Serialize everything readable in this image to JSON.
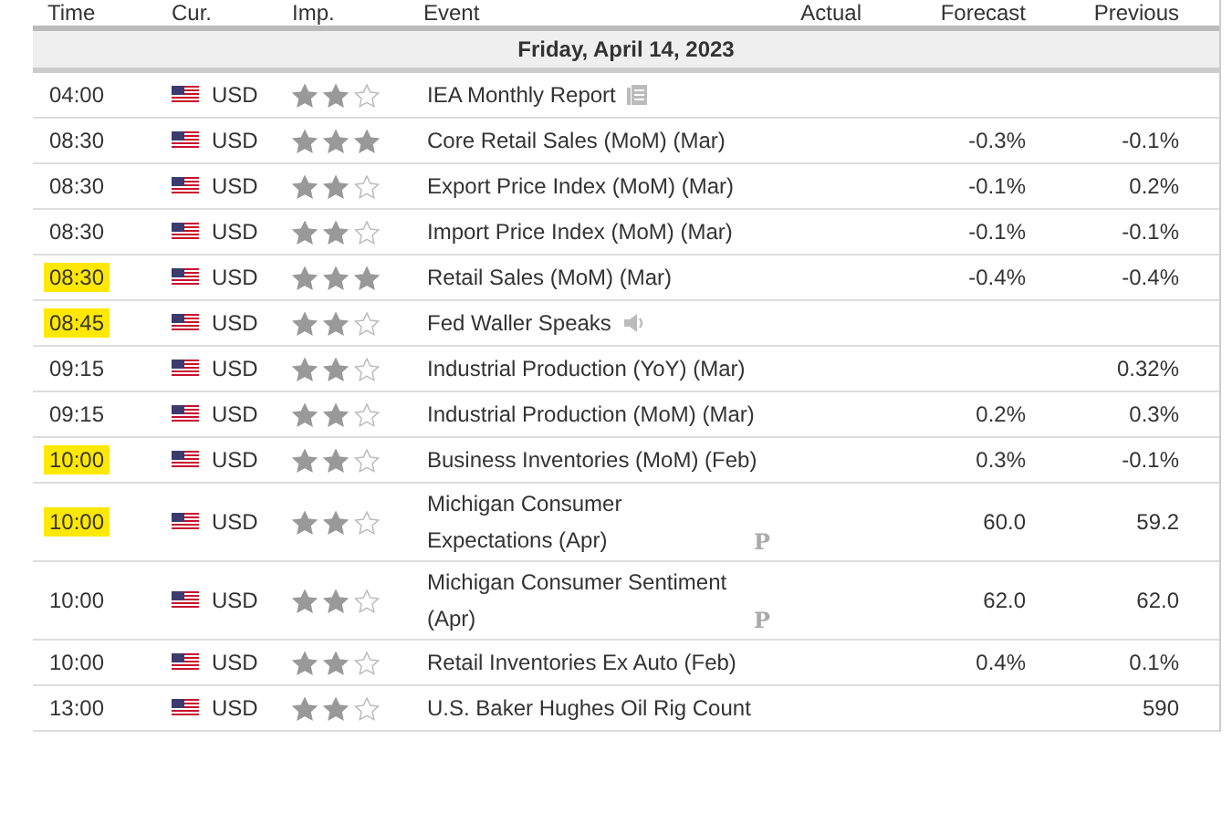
{
  "columns": [
    "Time",
    "Cur.",
    "Imp.",
    "Event",
    "Actual",
    "Forecast",
    "Previous"
  ],
  "date": "Friday, April 14, 2023",
  "rows": [
    {
      "time": "04:00",
      "currency": "USD",
      "stars": 2,
      "event": "IEA Monthly Report",
      "kind": "report",
      "highlighted": false
    },
    {
      "time": "08:30",
      "currency": "USD",
      "stars": 3,
      "event": "Core Retail Sales (MoM) (Mar)",
      "forecast": "-0.3%",
      "previous": "-0.1%",
      "highlighted": false
    },
    {
      "time": "08:30",
      "currency": "USD",
      "stars": 2,
      "event": "Export Price Index (MoM) (Mar)",
      "forecast": "-0.1%",
      "previous": "0.2%",
      "highlighted": false
    },
    {
      "time": "08:30",
      "currency": "USD",
      "stars": 2,
      "event": "Import Price Index (MoM) (Mar)",
      "forecast": "-0.1%",
      "previous": "-0.1%",
      "highlighted": false
    },
    {
      "time": "08:30",
      "currency": "USD",
      "stars": 3,
      "event": "Retail Sales (MoM) (Mar)",
      "forecast": "-0.4%",
      "previous": "-0.4%",
      "highlighted": true
    },
    {
      "time": "08:45",
      "currency": "USD",
      "stars": 2,
      "event": "Fed Waller Speaks",
      "kind": "speech",
      "highlighted": true
    },
    {
      "time": "09:15",
      "currency": "USD",
      "stars": 2,
      "event": "Industrial Production (YoY) (Mar)",
      "previous": "0.32%",
      "highlighted": false
    },
    {
      "time": "09:15",
      "currency": "USD",
      "stars": 2,
      "event": "Industrial Production (MoM) (Mar)",
      "forecast": "0.2%",
      "previous": "0.3%",
      "highlighted": false
    },
    {
      "time": "10:00",
      "currency": "USD",
      "stars": 2,
      "event": "Business Inventories (MoM) (Feb)",
      "forecast": "0.3%",
      "previous": "-0.1%",
      "highlighted": true
    },
    {
      "time": "10:00",
      "currency": "USD",
      "stars": 2,
      "event": "Michigan Consumer Expectations (Apr)",
      "badge": "P",
      "forecast": "60.0",
      "previous": "59.2",
      "highlighted": true
    },
    {
      "time": "10:00",
      "currency": "USD",
      "stars": 2,
      "event": "Michigan Consumer Sentiment (Apr)",
      "badge": "P",
      "forecast": "62.0",
      "previous": "62.0",
      "highlighted": false
    },
    {
      "time": "10:00",
      "currency": "USD",
      "stars": 2,
      "event": "Retail Inventories Ex Auto (Feb)",
      "forecast": "0.4%",
      "previous": "0.1%",
      "highlighted": false
    },
    {
      "time": "13:00",
      "currency": "USD",
      "stars": 2,
      "event": "U.S. Baker Hughes Oil Rig Count",
      "previous": "590",
      "highlighted": false
    }
  ]
}
